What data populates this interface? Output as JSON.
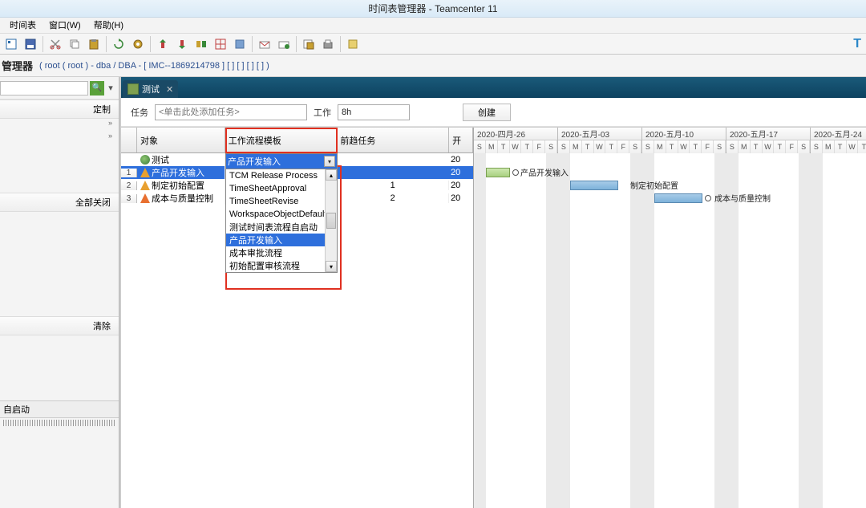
{
  "title": "时间表管理器 - Teamcenter 11",
  "menu": {
    "m1": "时间表",
    "m2": "窗口(W)",
    "m3": "帮助(H)"
  },
  "breadcrumb": {
    "title": "管理器",
    "path": "( root ( root ) - dba / DBA - [ IMC--1869214798 ] [  ] [ ] [  ] [  ] )"
  },
  "left": {
    "custom": "定制",
    "closeall": "全部关闭",
    "clear": "清除",
    "autostart": "自启动"
  },
  "tab": {
    "label": "测试"
  },
  "form": {
    "tasklbl": "任务",
    "taskph": "<单击此处添加任务>",
    "worklbl": "工作",
    "workval": "8h",
    "createlbl": "创建"
  },
  "grid": {
    "headers": {
      "obj": "对象",
      "wf": "工作流程模板",
      "pred": "前趋任务",
      "start": "开"
    },
    "rows": [
      {
        "num": "",
        "obj": "测试",
        "icon": "world",
        "wf": "",
        "pred": "",
        "start": "20"
      },
      {
        "num": "1",
        "obj": "产品开发输入",
        "icon": "task",
        "wf": "产品开发输入",
        "pred": "",
        "start": "20",
        "selected": true
      },
      {
        "num": "2",
        "obj": "制定初始配置",
        "icon": "task",
        "wf": "",
        "pred": "1",
        "start": "20"
      },
      {
        "num": "3",
        "obj": "成本与质量控制",
        "icon": "warn",
        "wf": "",
        "pred": "2",
        "start": "20"
      }
    ]
  },
  "combo": {
    "selected": "产品开发输入",
    "options": [
      "TCM Release Process",
      "TimeSheetApproval",
      "TimeSheetRevise",
      "WorkspaceObjectDefault",
      "测试时间表流程自启动",
      "产品开发输入",
      "成本审批流程",
      "初始配置审核流程"
    ],
    "highlight_index": 5
  },
  "gantt": {
    "weeks": [
      "2020-四月-26",
      "2020-五月-03",
      "2020-五月-10",
      "2020-五月-17",
      "2020-五月-24"
    ],
    "days": [
      "S",
      "M",
      "T",
      "W",
      "T",
      "F",
      "S"
    ],
    "bars": [
      {
        "label": "产品开发输入"
      },
      {
        "label": "制定初始配置"
      },
      {
        "label": "成本与质量控制"
      }
    ]
  }
}
